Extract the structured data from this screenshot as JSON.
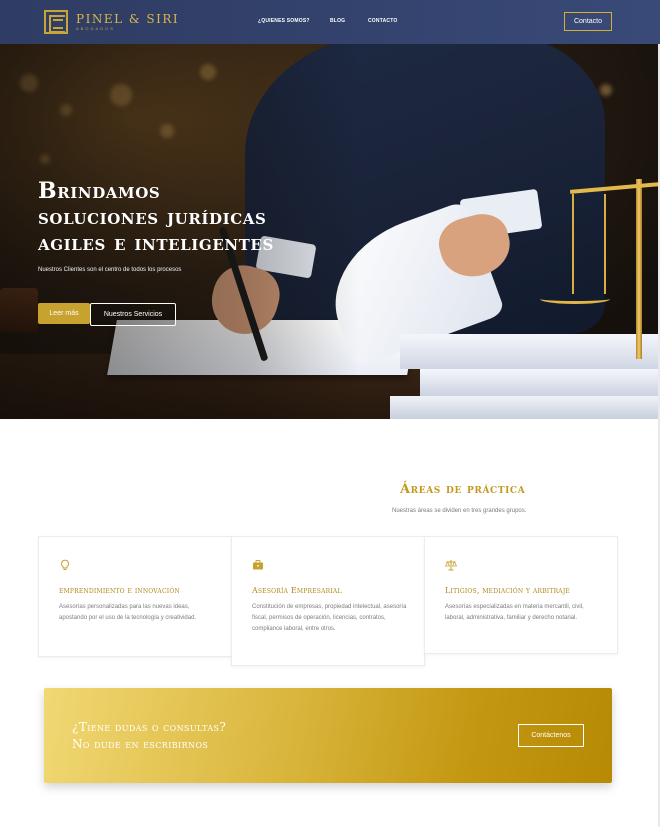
{
  "header": {
    "logo_name": "PINEL & SIRI",
    "logo_sub": "ABOGADOS",
    "nav": [
      {
        "label": "¿QUIENES SOMOS?"
      },
      {
        "label": "BLOG"
      },
      {
        "label": "CONTACTO"
      }
    ],
    "contact_label": "Contacto"
  },
  "hero": {
    "title": "Brindamos\nsoluciones jurídicas\nagiles e inteligentes",
    "subtitle": "Nuestros Clientes son el centro de todos los procesos",
    "primary_button": "Leer más",
    "secondary_button": "Nuestros Servicios"
  },
  "practice": {
    "title": "Áreas de práctica",
    "subtitle": "Nuestras áreas se dividen en tres grandes grupos.",
    "cards": [
      {
        "icon": "lightbulb-icon",
        "title": "emprendimiento e innovación",
        "desc": "Asesorías personalizadas para las nuevas ideas, apostando por el uso de la tecnología y creatividad."
      },
      {
        "icon": "briefcase-icon",
        "title": "Asesoría Empresarial",
        "desc": "Constitución de empresas, propiedad intelectual, asesoría fiscal, permisos de operación, licencias, contratos, compliance laboral, entre otros."
      },
      {
        "icon": "scale-icon",
        "title": "Litigios, mediación y arbitraje",
        "desc": "Asesorías especializadas en materia mercantil, civil, laboral, administrativa, familiar y derecho notarial."
      }
    ]
  },
  "cta": {
    "title": "¿Tiene dudas o consultas?\nNo dude en escribirnos",
    "button": "Contáctenos"
  },
  "colors": {
    "gold": "#c8a22f",
    "header_blue": "#33426c"
  }
}
